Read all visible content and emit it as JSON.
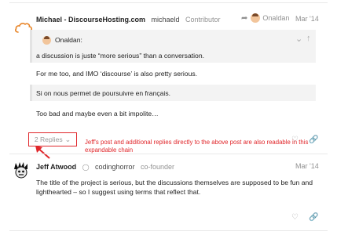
{
  "post1": {
    "author_display": "Michael - DiscourseHosting.com",
    "username": "michaeld",
    "role": "Contributor",
    "reply_to": "Onaldan",
    "date": "Mar '14",
    "quote": {
      "author": "Onaldan:",
      "text": "a discussion is juste “more serious” than a conversation."
    },
    "paragraph1": "For me too, and IMO ‘discourse’ is also pretty serious.",
    "quote2_text": "Si on nous permet de poursuivre en français.",
    "paragraph2": "Too bad and maybe even a bit impolite…",
    "replies_button": "2 Replies",
    "annotation": "Jeff's post and additional replies directly to the above post are also readable in this expandable chain"
  },
  "post2": {
    "author_display": "Jeff Atwood",
    "username": "codinghorror",
    "role": "co-founder",
    "date": "Mar '14",
    "paragraph": "The title of the project is serious, but the discussions themselves are supposed to be fun and lighthearted – so I suggest using terms that reflect that."
  },
  "colors": {
    "accent_red": "#e0262a",
    "avatar_orange": "#e8862a",
    "muted": "#919191"
  },
  "icons": [
    "cloud-logo-icon",
    "reply-arrow-icon",
    "chevron-down-icon",
    "arrow-up-icon",
    "heart-icon",
    "link-icon",
    "shield-icon"
  ]
}
